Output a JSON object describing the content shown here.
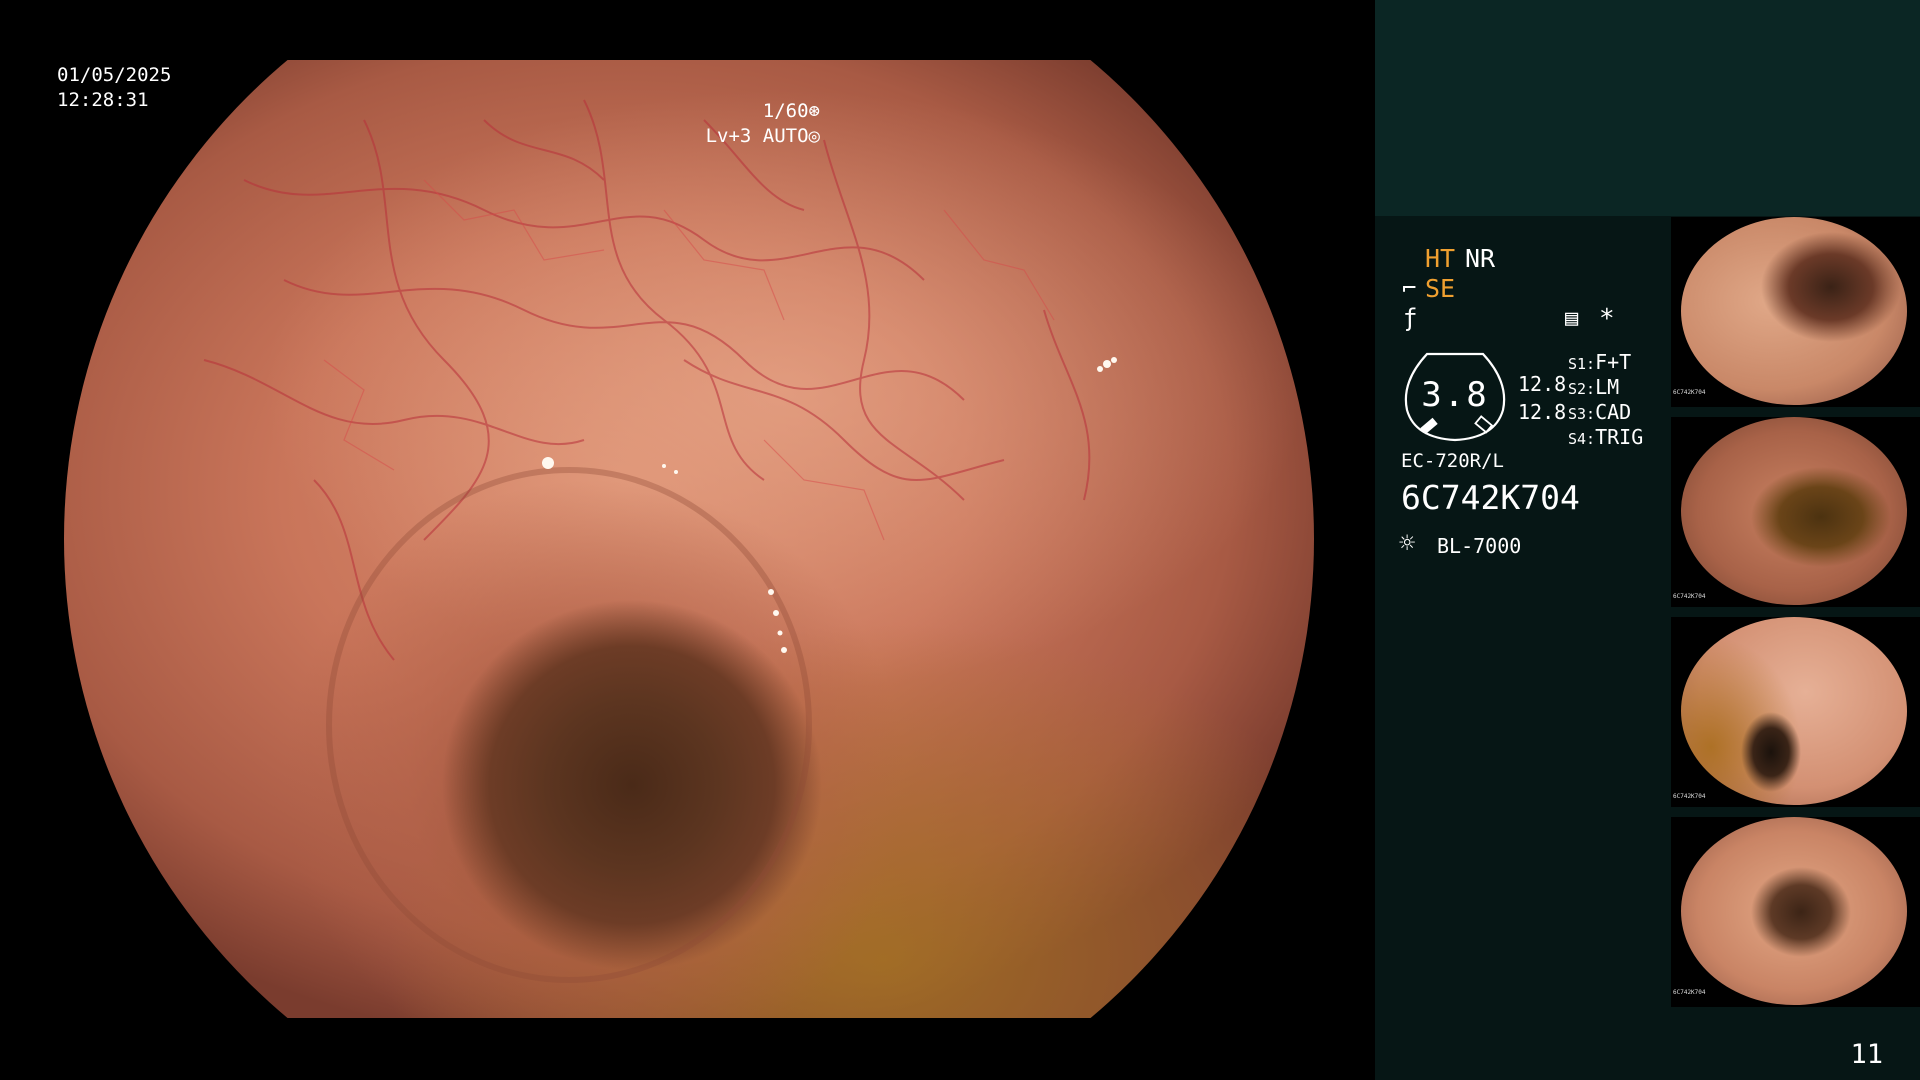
{
  "osd": {
    "date": "01/05/2025",
    "time": "12:28:31",
    "shutter": "1/60",
    "shutter_icon": "aperture-icon",
    "exposure": "Lv+3 AUTO",
    "exposure_icon": "iris-icon"
  },
  "panel": {
    "mode_ht": "HT",
    "mode_nr": "NR",
    "mode_se": "SE",
    "gauge_value": "3.8",
    "value_1": "12.8",
    "value_2": "12.8",
    "switches": [
      {
        "key": "S1:",
        "value": "F+T"
      },
      {
        "key": "S2:",
        "value": "LM"
      },
      {
        "key": "S3:",
        "value": "CAD"
      },
      {
        "key": "S4:",
        "value": "TRIG"
      }
    ],
    "scope_model": "EC-720R/L",
    "scope_serial": "6C742K704",
    "light_source": "BL-7000",
    "page_number": "11",
    "colors": {
      "orange": "#f0a030",
      "panel_bg": "#061615",
      "panel_top": "#0b2624"
    }
  },
  "thumbnails": [
    {
      "label": "thumbnail-1",
      "serial": "6C742K704"
    },
    {
      "label": "thumbnail-2",
      "serial": "6C742K704"
    },
    {
      "label": "thumbnail-3",
      "serial": "6C742K704"
    },
    {
      "label": "thumbnail-4",
      "serial": "6C742K704"
    }
  ]
}
